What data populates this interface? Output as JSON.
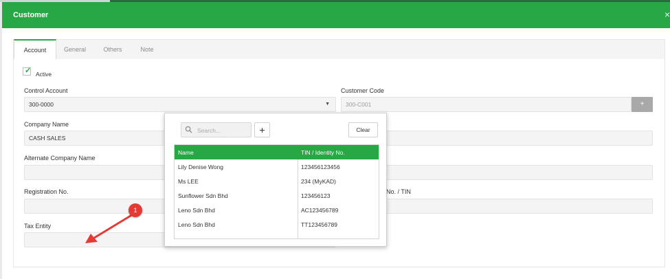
{
  "header": {
    "title": "Customer",
    "close": "×"
  },
  "tabs": [
    {
      "label": "Account"
    },
    {
      "label": "General"
    },
    {
      "label": "Others"
    },
    {
      "label": "Note"
    }
  ],
  "form": {
    "active_label": "Active",
    "control_account_label": "Control Account",
    "control_account_value": "300-0000",
    "customer_code_label": "Customer Code",
    "customer_code_value": "300-C001",
    "customer_code_add": "+",
    "company_name_label": "Company Name",
    "company_name_value": "CASH SALES",
    "alt_company_label": "Alternate Company Name",
    "registration_label": "Registration No.",
    "tin_label": "No. / TIN",
    "tax_entity_label": "Tax Entity"
  },
  "popup": {
    "search_placeholder": "Search...",
    "add_label": "+",
    "clear_label": "Clear",
    "columns": {
      "name": "Name",
      "tin": "TIN / Identity No."
    },
    "rows": [
      {
        "name": "Lily Denise Wong",
        "tin": "123456123456"
      },
      {
        "name": "Ms LEE",
        "tin": "234 (MyKAD)"
      },
      {
        "name": "Sunflower Sdn Bhd",
        "tin": "123456123"
      },
      {
        "name": "Leno Sdn Bhd",
        "tin": "AC123456789"
      },
      {
        "name": "Leno Sdn Bhd",
        "tin": "TT123456789"
      }
    ]
  },
  "annotation": {
    "badge": "1"
  },
  "colors": {
    "accent": "#28a745",
    "badge": "#e53935"
  }
}
